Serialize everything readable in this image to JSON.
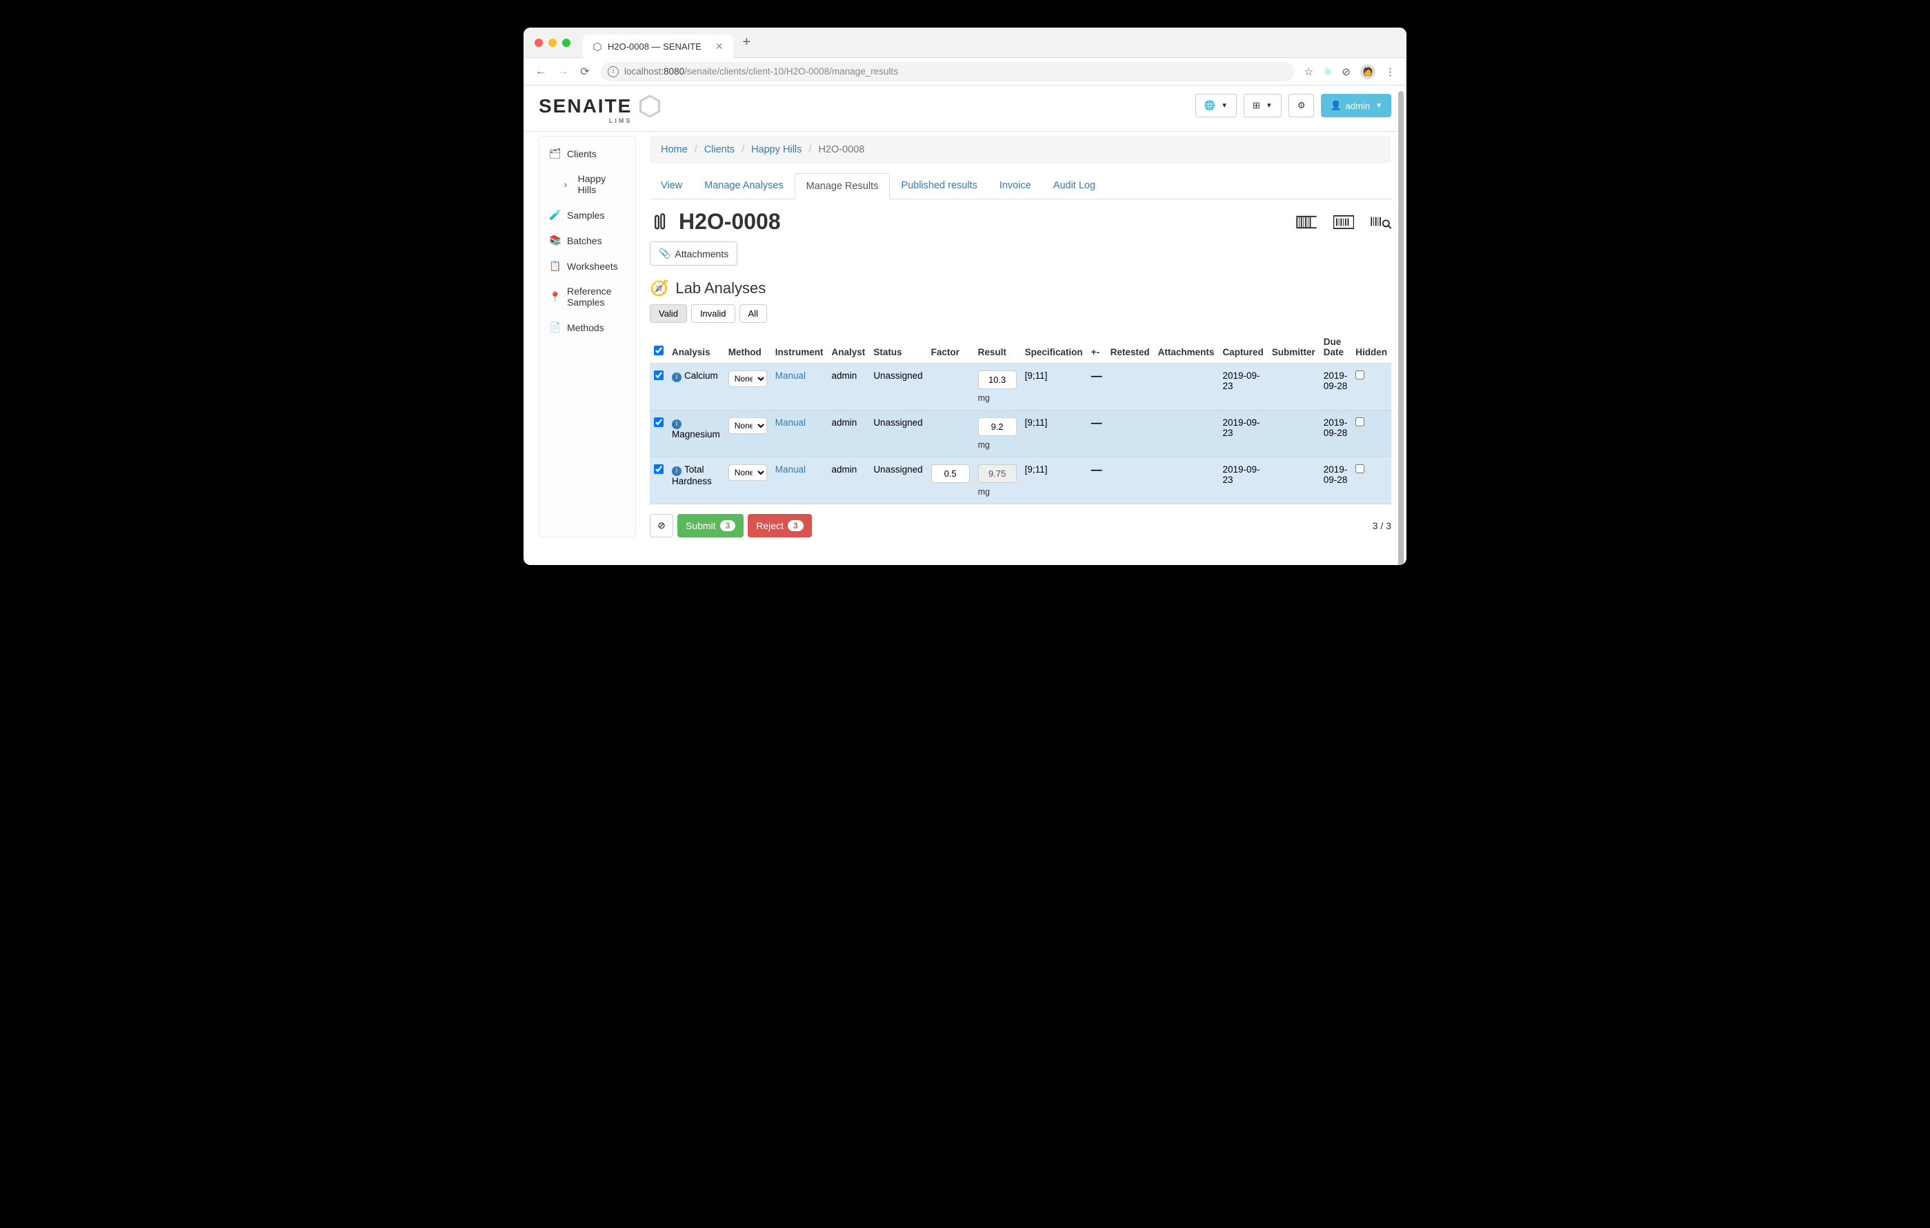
{
  "browser": {
    "tab_title": "H2O-0008 — SENAITE",
    "url_host": "localhost",
    "url_port": ":8080",
    "url_path": "/senaite/clients/client-10/H2O-0008/manage_results"
  },
  "header": {
    "logo_text": "SENAITE",
    "logo_sub": "LIMS",
    "user_label": "admin"
  },
  "sidebar": {
    "items": [
      {
        "label": "Clients"
      },
      {
        "label": "Happy Hills"
      },
      {
        "label": "Samples"
      },
      {
        "label": "Batches"
      },
      {
        "label": "Worksheets"
      },
      {
        "label": "Reference Samples"
      },
      {
        "label": "Methods"
      }
    ]
  },
  "breadcrumb": {
    "items": [
      "Home",
      "Clients",
      "Happy Hills"
    ],
    "current": "H2O-0008"
  },
  "tabs": [
    "View",
    "Manage Analyses",
    "Manage Results",
    "Published results",
    "Invoice",
    "Audit Log"
  ],
  "active_tab": "Manage Results",
  "page": {
    "title": "H2O-0008",
    "attachments_label": "Attachments",
    "section_title": "Lab Analyses"
  },
  "filters": [
    "Valid",
    "Invalid",
    "All"
  ],
  "active_filter": "Valid",
  "table": {
    "columns": [
      "Analysis",
      "Method",
      "Instrument",
      "Analyst",
      "Status",
      "Factor",
      "Result",
      "Specification",
      "+-",
      "Retested",
      "Attachments",
      "Captured",
      "Submitter",
      "Due Date",
      "Hidden"
    ],
    "rows": [
      {
        "analysis": "Calcium",
        "method": "None",
        "instrument": "Manual",
        "analyst": "admin",
        "status": "Unassigned",
        "factor": "",
        "result": "10.3",
        "result_disabled": false,
        "unit": "mg",
        "spec": "[9;11]",
        "pm": "—",
        "captured": "2019-09-23",
        "due": "2019-09-28"
      },
      {
        "analysis": "Magnesium",
        "method": "None",
        "instrument": "Manual",
        "analyst": "admin",
        "status": "Unassigned",
        "factor": "",
        "result": "9.2",
        "result_disabled": false,
        "unit": "mg",
        "spec": "[9;11]",
        "pm": "—",
        "captured": "2019-09-23",
        "due": "2019-09-28"
      },
      {
        "analysis": "Total Hardness",
        "method": "None",
        "instrument": "Manual",
        "analyst": "admin",
        "status": "Unassigned",
        "factor": "0.5",
        "result": "9.75",
        "result_disabled": true,
        "unit": "mg",
        "spec": "[9;11]",
        "pm": "—",
        "captured": "2019-09-23",
        "due": "2019-09-28"
      }
    ]
  },
  "footer": {
    "submit_label": "Submit",
    "submit_count": "3",
    "reject_label": "Reject",
    "reject_count": "3",
    "page_count": "3 / 3"
  }
}
